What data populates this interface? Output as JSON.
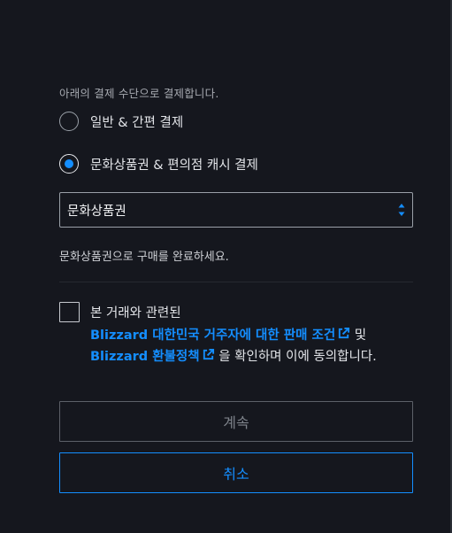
{
  "payment": {
    "intro": "아래의 결제 수단으로 결제합니다.",
    "options": [
      {
        "label": "일반 & 간편 결제",
        "selected": false
      },
      {
        "label": "문화상품권 & 편의점 캐시 결제",
        "selected": true
      }
    ],
    "select": {
      "value": "문화상품권"
    },
    "note": "문화상품권으로 구매를 완료하세요."
  },
  "agreement": {
    "checked": false,
    "prefix": "본 거래와 관련된",
    "terms_link": "Blizzard 대한민국 거주자에 대한 판매 조건",
    "and": " 및",
    "refund_link": "Blizzard 환불정책",
    "suffix": " 을 확인하며 이에 동의합니다."
  },
  "buttons": {
    "continue": "계속",
    "cancel": "취소"
  },
  "colors": {
    "background": "#15171e",
    "accent": "#148eff",
    "text": "#e2e4e8",
    "muted": "#a7aab1"
  },
  "icons": {
    "external_link": "external-link-icon",
    "select_arrows": "sort-arrows-icon"
  }
}
